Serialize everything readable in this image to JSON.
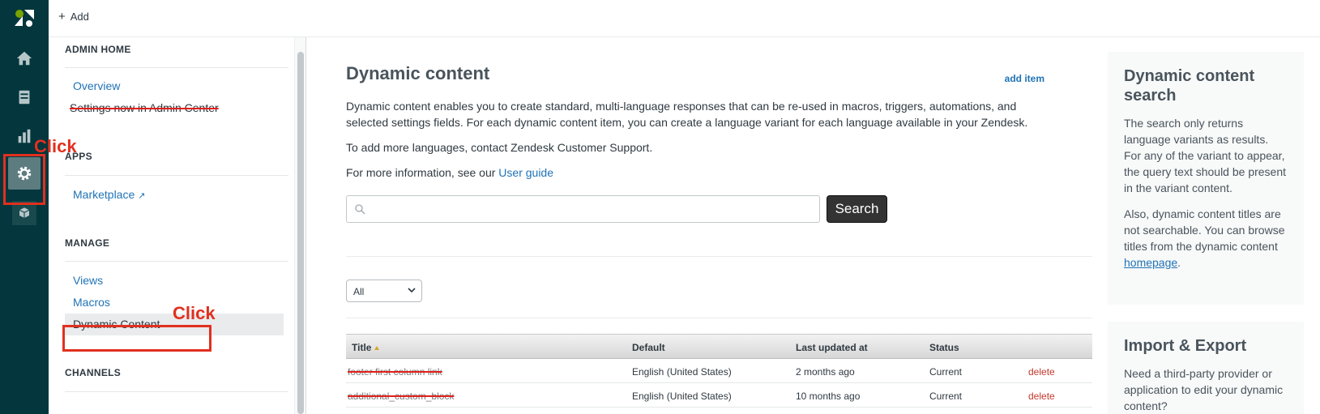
{
  "topbar": {
    "add_label": "Add"
  },
  "rail": {
    "icons": [
      "zendesk-logo",
      "home-icon",
      "tickets-icon",
      "reporting-icon",
      "admin-gear-icon",
      "apps-box-icon"
    ]
  },
  "admin_nav": {
    "sections": [
      {
        "title": "ADMIN HOME",
        "items": [
          "Overview",
          "Settings now in Admin Center"
        ]
      },
      {
        "title": "APPS",
        "items": [
          "Marketplace"
        ]
      },
      {
        "title": "MANAGE",
        "items": [
          "Views",
          "Macros",
          "Dynamic Content"
        ]
      },
      {
        "title": "CHANNELS",
        "items": []
      }
    ]
  },
  "annotations": {
    "click_1": "Click",
    "click_2": "Click"
  },
  "main": {
    "title": "Dynamic content",
    "add_item": "add item",
    "desc1": "Dynamic content enables you to create standard, multi-language responses that can be re-used in macros, triggers, automations, and selected settings fields. For each dynamic content item, you can create a language variant for each language available in your Zendesk.",
    "desc2": "To add more languages, contact Zendesk Customer Support.",
    "desc3_prefix": "For more information, see our ",
    "desc3_link": "User guide",
    "search_placeholder": "",
    "search_button": "Search",
    "filter_value": "All",
    "table": {
      "headers": [
        "Title",
        "Default",
        "Last updated at",
        "Status"
      ],
      "rows": [
        {
          "title": "footer first column link",
          "default": "English (United States)",
          "updated": "2 months ago",
          "status": "Current",
          "action": "delete"
        },
        {
          "title": "additional_custom_block",
          "default": "English (United States)",
          "updated": "10 months ago",
          "status": "Current",
          "action": "delete"
        }
      ]
    }
  },
  "panels": {
    "search": {
      "title": "Dynamic content search",
      "text1": "The search only returns language variants as results. For any of the variant to appear, the query text should be present in the variant content.",
      "text2_prefix": "Also, dynamic content titles are not searchable. You can browse titles from the dynamic content ",
      "text2_link": "homepage",
      "text2_suffix": "."
    },
    "import": {
      "title": "Import & Export",
      "text": "Need a third-party provider or application to edit your dynamic content?"
    }
  },
  "colors": {
    "rail": "#03363d",
    "link": "#1f73b7",
    "annotation": "#e1301f"
  }
}
